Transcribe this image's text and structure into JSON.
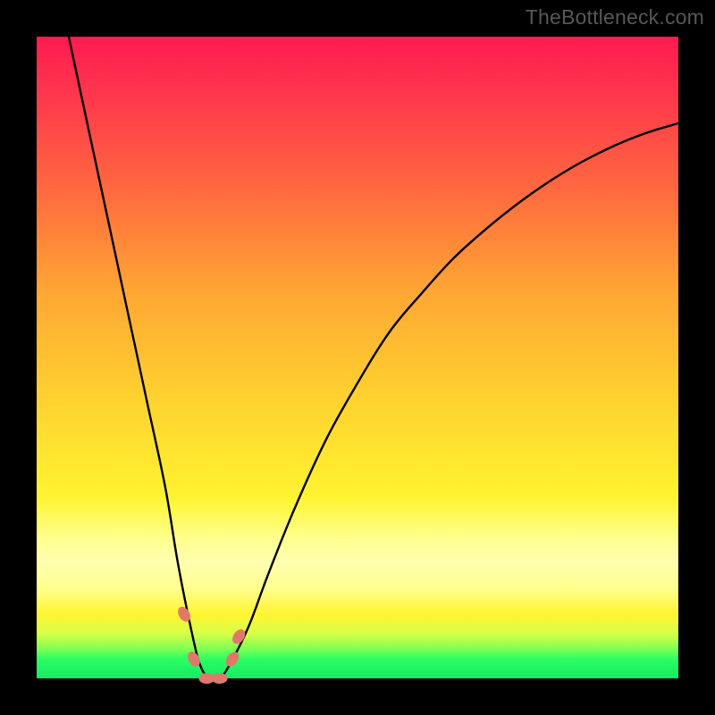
{
  "watermark": "TheBottleneck.com",
  "chart_data": {
    "type": "line",
    "title": "",
    "xlabel": "",
    "ylabel": "",
    "xlim": [
      0,
      100
    ],
    "ylim": [
      0,
      100
    ],
    "grid": false,
    "series": [
      {
        "name": "bottleneck-curve",
        "x": [
          5,
          8,
          11,
          14,
          17,
          20,
          22,
          24,
          25.5,
          27,
          28.5,
          30,
          33,
          36,
          40,
          45,
          50,
          55,
          60,
          65,
          70,
          75,
          80,
          85,
          90,
          95,
          100
        ],
        "y": [
          100,
          86,
          72,
          58,
          44,
          30,
          18,
          8,
          2,
          0,
          0,
          2,
          8,
          16,
          26,
          37,
          46,
          54,
          60,
          65.5,
          70,
          74,
          77.5,
          80.5,
          83,
          85,
          86.5
        ]
      }
    ],
    "markers": [
      {
        "name": "left-upper-dot",
        "x": 23.0,
        "y": 10.0
      },
      {
        "name": "left-lower-dot",
        "x": 24.5,
        "y": 3.0
      },
      {
        "name": "trough-dot-1",
        "x": 26.5,
        "y": 0.0
      },
      {
        "name": "trough-dot-2",
        "x": 28.5,
        "y": 0.0
      },
      {
        "name": "right-lower-dot",
        "x": 30.5,
        "y": 3.0
      },
      {
        "name": "right-upper-dot",
        "x": 31.5,
        "y": 6.5
      }
    ],
    "gradient_stops": [
      {
        "pos": 0,
        "color": "#ff1a50"
      },
      {
        "pos": 55,
        "color": "#ffce2f"
      },
      {
        "pos": 82,
        "color": "#ffffb0"
      },
      {
        "pos": 100,
        "color": "#17e865"
      }
    ]
  }
}
